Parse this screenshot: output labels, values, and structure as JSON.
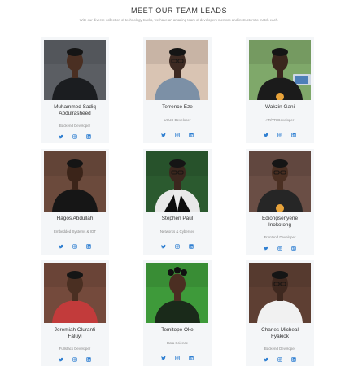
{
  "header": {
    "title": "MEET OUR TEAM LEADS",
    "subtitle": "With our diverse collection of technology tracks, we have an amazing team of developers mentors and instructors to match each."
  },
  "colors": {
    "card_bg": "#f4f6f8",
    "icon": "#2f7fd1"
  },
  "members": [
    {
      "name_lines": [
        "Muhammed Sadiq",
        "Abdulrasheed"
      ],
      "role": "Backend Developer",
      "photo": "tech-shirt-man",
      "bg": "#5b5e63",
      "shirt": "#1b1d20",
      "skin": "#4a2f22"
    },
    {
      "name_lines": [
        "Terrence Eze"
      ],
      "role": "UI/UX Developer",
      "photo": "denim-shirt-man",
      "bg": "#d9c4b3",
      "shirt": "#7c90a6",
      "skin": "#3e2a22"
    },
    {
      "name_lines": [
        "Wakzin Gani"
      ],
      "role": "AR/VR Developer",
      "photo": "hub-shirt-man-laptop",
      "bg": "#7fa86a",
      "shirt": "#1b1b1b",
      "skin": "#3a261d"
    },
    {
      "name_lines": [
        "Hagos Abdullah"
      ],
      "role": "Embedded Systems & IOT",
      "photo": "black-shirt-man",
      "bg": "#6b4a3c",
      "shirt": "#161616",
      "skin": "#3b2419"
    },
    {
      "name_lines": [
        "Stephen Paul"
      ],
      "role": "Networks & Cybersec",
      "photo": "suit-man-outdoor",
      "bg": "#2b5a2f",
      "shirt": "#e8e8e8",
      "skin": "#3b271e"
    },
    {
      "name_lines": [
        "Ediongsenyene",
        "Inokotong"
      ],
      "role": "Frontend Developer",
      "photo": "hub-shirt-man-glasses",
      "bg": "#6a4e45",
      "shirt": "#262626",
      "skin": "#4a2f22"
    },
    {
      "name_lines": [
        "Jeremiah Oluranti",
        "Faluyi"
      ],
      "role": "Fullstack Developer",
      "photo": "red-shirt-man",
      "bg": "#744a3c",
      "shirt": "#c23b3b",
      "skin": "#4a2f22"
    },
    {
      "name_lines": [
        "Temitope Oke"
      ],
      "role": "Data Science",
      "photo": "woman-green-bg",
      "bg": "#3e9a3a",
      "shirt": "#1a2a1a",
      "skin": "#4b2e22"
    },
    {
      "name_lines": [
        "Charles Micheal",
        "Fyakiok"
      ],
      "role": "Backend Developer",
      "photo": "white-shirt-man",
      "bg": "#5e3f33",
      "shirt": "#f1f1f1",
      "skin": "#3e281f"
    }
  ],
  "social_icons": [
    "twitter-icon",
    "instagram-icon",
    "linkedin-icon"
  ]
}
